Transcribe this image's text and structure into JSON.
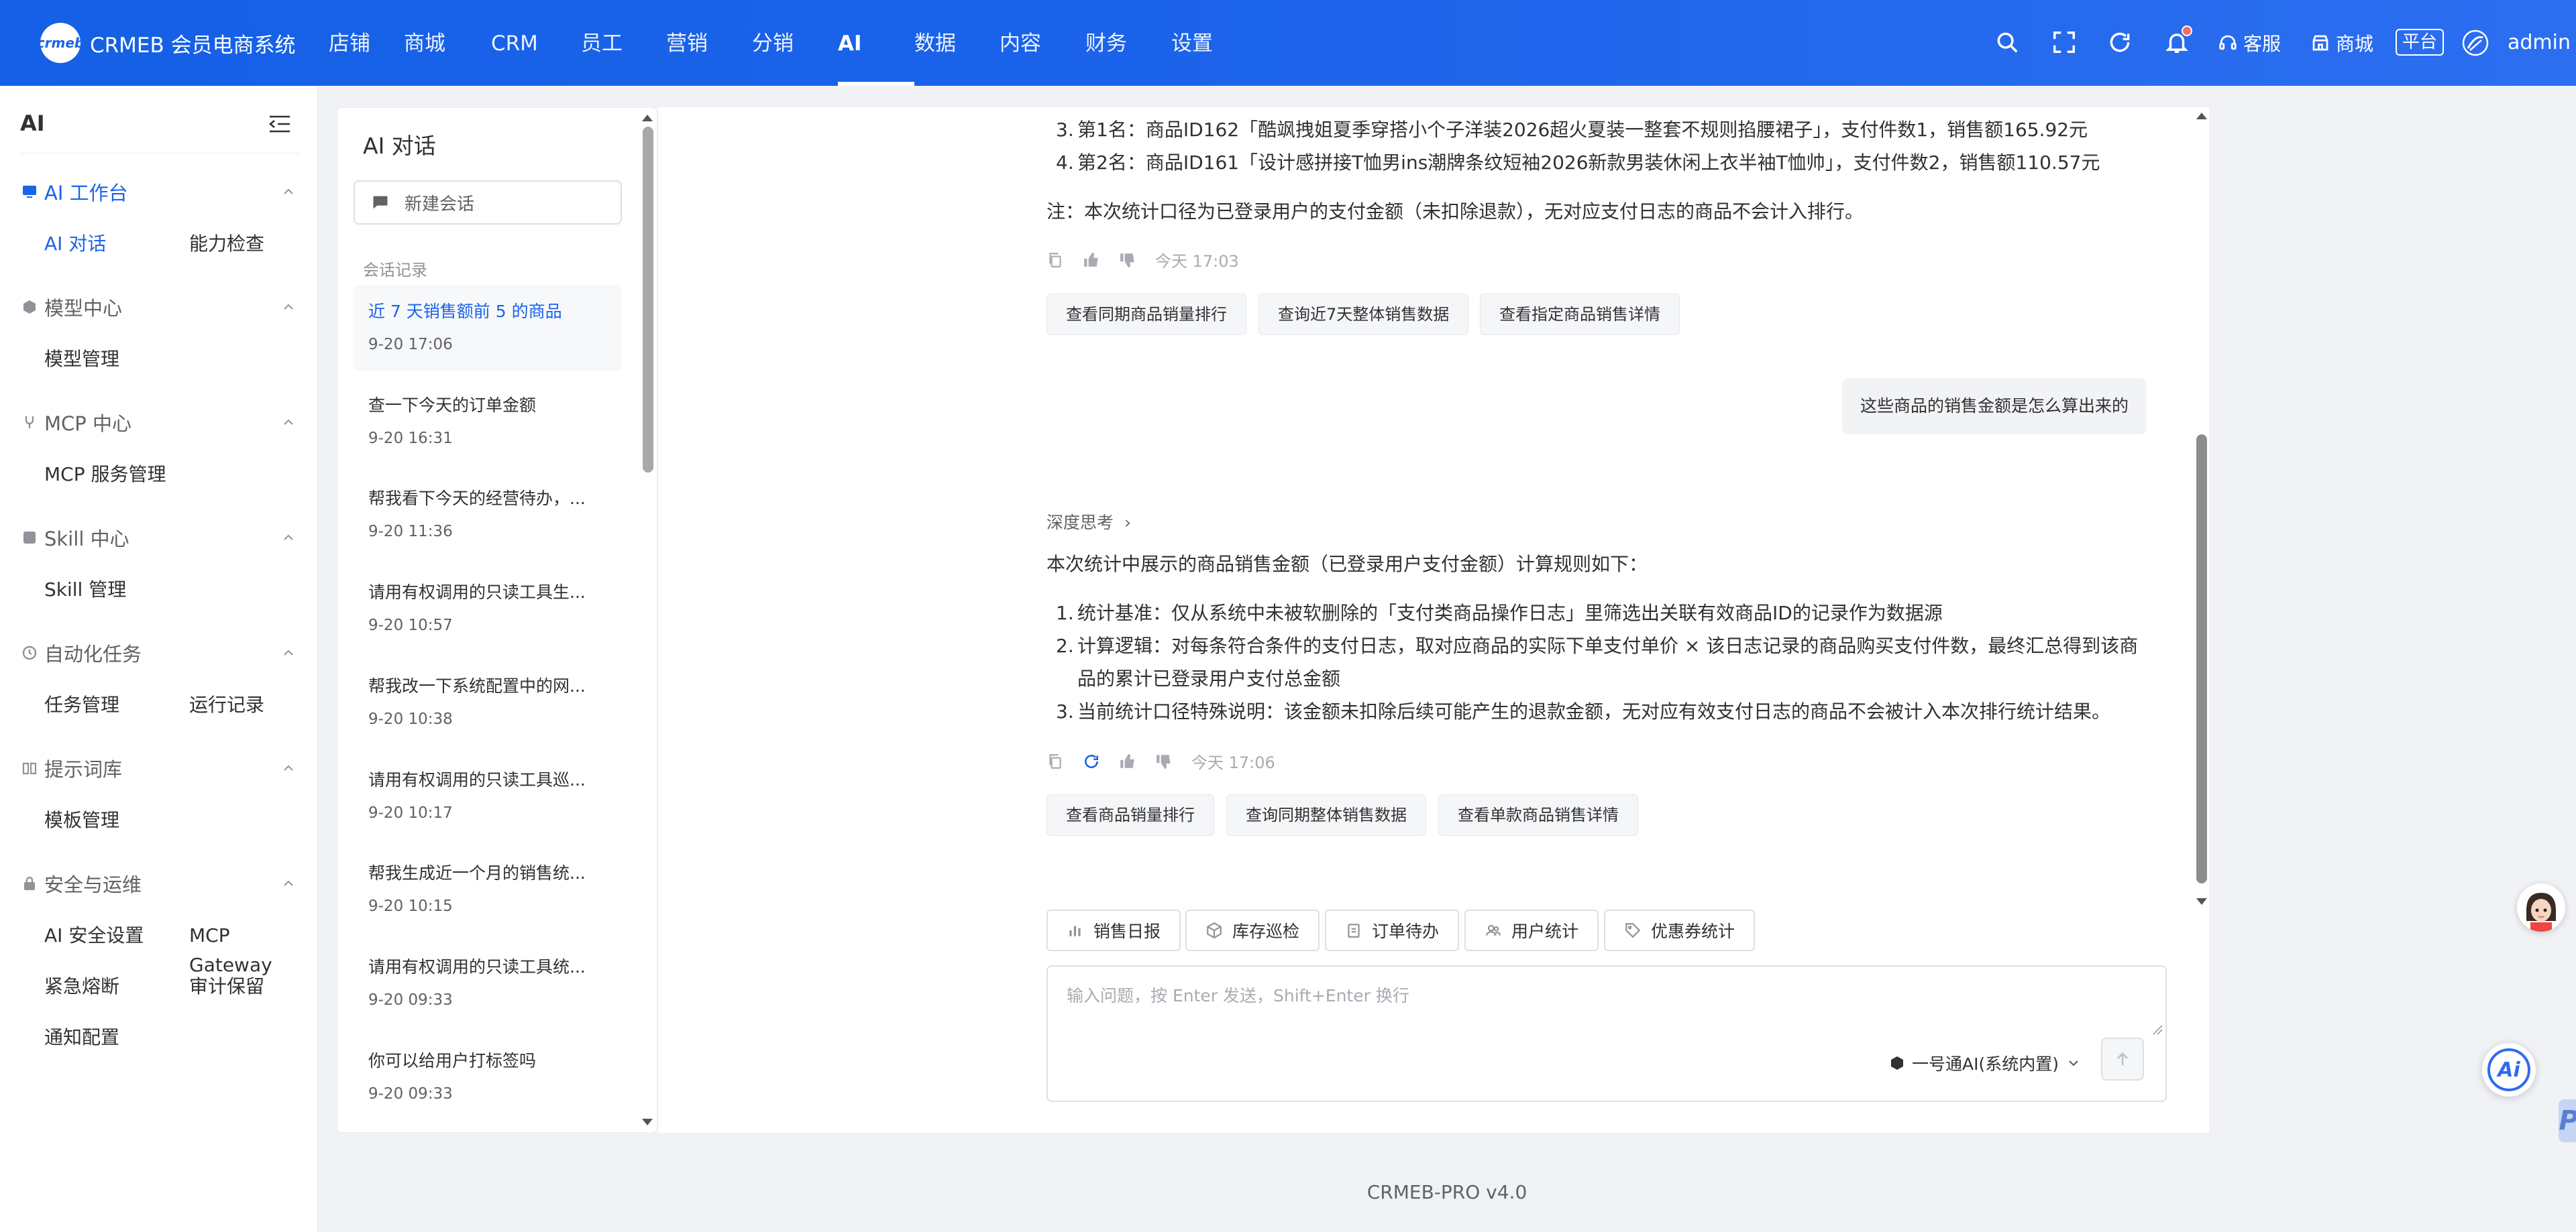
{
  "app": {
    "logo_mark": "crmeb",
    "title": "CRMEB 会员电商系统"
  },
  "topnav": [
    {
      "label": "店铺",
      "active": false
    },
    {
      "label": "商城",
      "active": false
    },
    {
      "label": "CRM",
      "active": false
    },
    {
      "label": "员工",
      "active": false
    },
    {
      "label": "营销",
      "active": false
    },
    {
      "label": "分销",
      "active": false
    },
    {
      "label": "AI",
      "active": true
    },
    {
      "label": "数据",
      "active": false
    },
    {
      "label": "内容",
      "active": false
    },
    {
      "label": "财务",
      "active": false
    },
    {
      "label": "设置",
      "active": false
    }
  ],
  "topbar_right": {
    "icons": [
      "search-icon",
      "fullscreen-icon",
      "refresh-icon",
      "bell-icon"
    ],
    "service_label": "客服",
    "mall_label": "商城",
    "platform_label": "平台",
    "user": "admin"
  },
  "sidebar": {
    "title": "AI",
    "groups": [
      {
        "label": "AI 工作台",
        "icon": "monitor-icon",
        "active": true,
        "items": [
          {
            "label": "AI 对话",
            "active": true
          },
          {
            "label": "能力检查",
            "active": false
          }
        ]
      },
      {
        "label": "模型中心",
        "icon": "cube-icon",
        "active": false,
        "items": [
          {
            "label": "模型管理",
            "active": false
          }
        ]
      },
      {
        "label": "MCP 中心",
        "icon": "plug-icon",
        "active": false,
        "items": [
          {
            "label": "MCP 服务管理",
            "active": false
          }
        ]
      },
      {
        "label": "Skill 中心",
        "icon": "box-icon",
        "active": false,
        "items": [
          {
            "label": "Skill 管理",
            "active": false
          }
        ]
      },
      {
        "label": "自动化任务",
        "icon": "clock-icon",
        "active": false,
        "items": [
          {
            "label": "任务管理",
            "active": false
          },
          {
            "label": "运行记录",
            "active": false
          }
        ]
      },
      {
        "label": "提示词库",
        "icon": "book-icon",
        "active": false,
        "items": [
          {
            "label": "模板管理",
            "active": false
          }
        ]
      },
      {
        "label": "安全与运维",
        "icon": "lock-icon",
        "active": false,
        "items": [
          {
            "label": "AI 安全设置",
            "active": false
          },
          {
            "label": "MCP Gateway",
            "active": false
          },
          {
            "label": "紧急熔断",
            "active": false
          },
          {
            "label": "审计保留",
            "active": false
          },
          {
            "label": "通知配置",
            "active": false
          }
        ]
      }
    ]
  },
  "conversations": {
    "title": "AI 对话",
    "new_label": "新建会话",
    "history_label": "会话记录",
    "items": [
      {
        "title": "近 7 天销售额前 5 的商品",
        "time": "9-20 17:06",
        "active": true
      },
      {
        "title": "查一下今天的订单金额",
        "time": "9-20 16:31",
        "active": false
      },
      {
        "title": "帮我看下今天的经营待办，...",
        "time": "9-20 11:36",
        "active": false
      },
      {
        "title": "请用有权调用的只读工具生...",
        "time": "9-20 10:57",
        "active": false
      },
      {
        "title": "帮我改一下系统配置中的网...",
        "time": "9-20 10:38",
        "active": false
      },
      {
        "title": "请用有权调用的只读工具巡...",
        "time": "9-20 10:17",
        "active": false
      },
      {
        "title": "帮我生成近一个月的销售统...",
        "time": "9-20 10:15",
        "active": false
      },
      {
        "title": "请用有权调用的只读工具统...",
        "time": "9-20 09:33",
        "active": false
      },
      {
        "title": "你可以给用户打标签吗",
        "time": "9-20 09:33",
        "active": false
      }
    ]
  },
  "chat": {
    "msg1": {
      "list": [
        {
          "num": "3.",
          "text": "第1名：商品ID162「酷飒拽姐夏季穿搭小个子洋装2026超火夏装一整套不规则掐腰裙子」，支付件数1，销售额165.92元"
        },
        {
          "num": "4.",
          "text": "第2名：商品ID161「设计感拼接T恤男ins潮牌条纹短袖2026新款男装休闲上衣半袖T恤帅」，支付件数2，销售额110.57元"
        }
      ],
      "note": "注：本次统计口径为已登录用户的支付金额（未扣除退款），无对应支付日志的商品不会计入排行。",
      "time": "今天 17:03",
      "suggestions": [
        "查看同期商品销量排行",
        "查询近7天整体销售数据",
        "查看指定商品销售详情"
      ]
    },
    "user_msg": "这些商品的销售金额是怎么算出来的",
    "msg2": {
      "think_label": "深度思考",
      "intro": "本次统计中展示的商品销售金额（已登录用户支付金额）计算规则如下：",
      "list": [
        {
          "num": "1.",
          "text": "统计基准：仅从系统中未被软删除的「支付类商品操作日志」里筛选出关联有效商品ID的记录作为数据源"
        },
        {
          "num": "2.",
          "text": "计算逻辑：对每条符合条件的支付日志，取对应商品的实际下单支付单价 × 该日志记录的商品购买支付件数，最终汇总得到该商"
        },
        {
          "num": "",
          "text": "品的累计已登录用户支付总金额"
        },
        {
          "num": "3.",
          "text": "当前统计口径特殊说明：该金额未扣除后续可能产生的退款金额，无对应有效支付日志的商品不会被计入本次排行统计结果。"
        }
      ],
      "time": "今天 17:06",
      "suggestions": [
        "查看商品销量排行",
        "查询同期整体销售数据",
        "查看单款商品销售详情"
      ]
    },
    "quick_actions": [
      {
        "label": "销售日报",
        "icon": "bar-chart-icon"
      },
      {
        "label": "库存巡检",
        "icon": "package-icon"
      },
      {
        "label": "订单待办",
        "icon": "clipboard-icon"
      },
      {
        "label": "用户统计",
        "icon": "users-icon"
      },
      {
        "label": "优惠券统计",
        "icon": "tag-icon"
      }
    ],
    "input_placeholder": "输入问题，按 Enter 发送，Shift+Enter 换行",
    "model_label": "一号通AI(系统内置)"
  },
  "footer": "CRMEB-PRO v4.0",
  "colors": {
    "primary": "#1b63ea",
    "topbar_gradient_end": "#2c6ef0",
    "text": "#303133",
    "muted": "#909399"
  }
}
